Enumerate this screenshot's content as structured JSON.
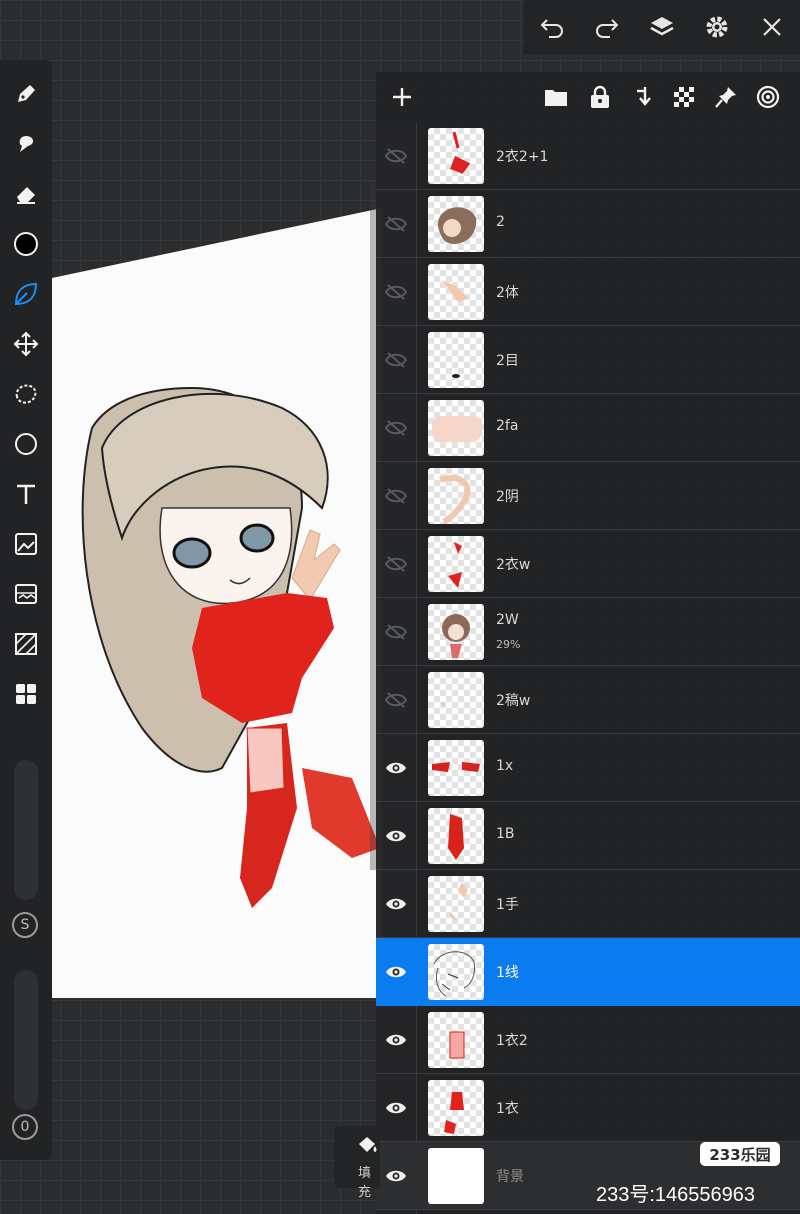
{
  "toolbar": {
    "undo_icon": "undo-icon",
    "redo_icon": "redo-icon",
    "layers_icon": "layers-icon",
    "settings_icon": "gear-icon",
    "close_icon": "close-icon"
  },
  "tools": [
    "pen-icon",
    "smudge-icon",
    "eraser-icon",
    "color-icon",
    "leaf-brush-icon",
    "move-icon",
    "lasso-icon",
    "ellipse-icon",
    "text-icon",
    "image-import-icon",
    "filter-icon",
    "perspective-icon",
    "grid-icon"
  ],
  "sliders": {
    "top_label": "S",
    "bottom_label": "0"
  },
  "colors": {
    "current": "#000000",
    "accent": "#0a7cf0",
    "panel": "#212224"
  },
  "layers_header_icons": [
    "add-icon",
    "folder-icon",
    "lock-icon",
    "merge-down-icon",
    "transparency-icon",
    "pin-icon",
    "reference-icon"
  ],
  "layers": [
    {
      "name": "2衣2+1",
      "visible": false,
      "opacity": ""
    },
    {
      "name": "2",
      "visible": false,
      "opacity": ""
    },
    {
      "name": "2体",
      "visible": false,
      "opacity": ""
    },
    {
      "name": "2目",
      "visible": false,
      "opacity": ""
    },
    {
      "name": "2fa",
      "visible": false,
      "opacity": ""
    },
    {
      "name": "2阴",
      "visible": false,
      "opacity": ""
    },
    {
      "name": "2衣w",
      "visible": false,
      "opacity": ""
    },
    {
      "name": "2W",
      "visible": false,
      "opacity": "29%"
    },
    {
      "name": "2稿w",
      "visible": false,
      "opacity": ""
    },
    {
      "name": "1x",
      "visible": true,
      "opacity": ""
    },
    {
      "name": "1B",
      "visible": true,
      "opacity": ""
    },
    {
      "name": "1手",
      "visible": true,
      "opacity": ""
    },
    {
      "name": "1线",
      "visible": true,
      "opacity": "",
      "selected": true
    },
    {
      "name": "1衣2",
      "visible": true,
      "opacity": ""
    },
    {
      "name": "1衣",
      "visible": true,
      "opacity": ""
    },
    {
      "name": "背景",
      "visible": true,
      "opacity": ""
    }
  ],
  "fill": {
    "label": "填充"
  },
  "watermark": {
    "logo": "233乐园",
    "text": "233号:146556963"
  }
}
